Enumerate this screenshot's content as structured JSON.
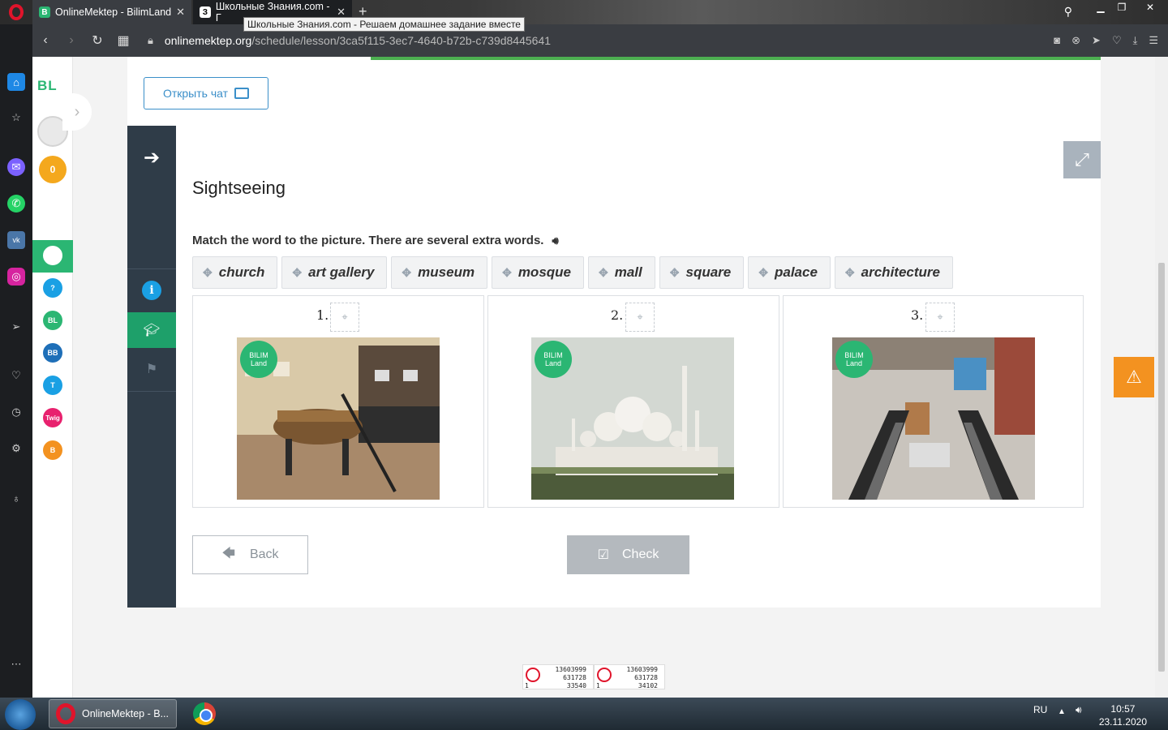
{
  "browser": {
    "tabs": [
      {
        "label": "OnlineMektep - BilimLand",
        "favicon": "B"
      },
      {
        "label": "Школьные Знания.com - Г",
        "favicon": "З"
      }
    ],
    "tooltip": "Школьные Знания.com - Решаем домашнее задание вместе",
    "url_host": "onlinemektep.org",
    "url_path": "/schedule/lesson/3ca5f115-3ec7-4640-b72b-c739d8445641"
  },
  "sidebar": {
    "logo": "BL",
    "coins": "0",
    "apps": [
      {
        "name": "online-mektep",
        "label": "",
        "color": "#2bb673"
      },
      {
        "name": "help",
        "label": "?",
        "color": "#1aa0e4"
      },
      {
        "name": "bilimland",
        "label": "BL",
        "color": "#2bb673"
      },
      {
        "name": "bilim-book",
        "label": "BB",
        "color": "#1e6fb8"
      },
      {
        "name": "bilim-test",
        "label": "T",
        "color": "#1aa0e4"
      },
      {
        "name": "twig",
        "label": "Twig",
        "color": "#e8216e"
      },
      {
        "name": "bilimal",
        "label": "B",
        "color": "#f39220"
      }
    ]
  },
  "lesson": {
    "chat_button": "Открыть чат",
    "title": "Sightseeing",
    "instruction": "Match the word to the picture. There are several extra words.",
    "words": [
      "church",
      "art gallery",
      "museum",
      "mosque",
      "mall",
      "square",
      "palace",
      "architecture"
    ],
    "cards": [
      {
        "number": "1.",
        "image": "museum-boat-photo"
      },
      {
        "number": "2.",
        "image": "mosque-photo"
      },
      {
        "number": "3.",
        "image": "mall-escalator-photo"
      }
    ],
    "image_badge": "BILIM Land",
    "back_button": "Back",
    "check_button": "Check"
  },
  "counters": [
    {
      "a": "13603999",
      "b": "631728",
      "c": "33540",
      "d": "1"
    },
    {
      "a": "13603999",
      "b": "631728",
      "c": "34102",
      "d": "1"
    }
  ],
  "taskbar": {
    "opera_label": "OnlineMektep - B...",
    "lang": "RU",
    "time": "10:57",
    "date": "23.11.2020"
  },
  "colors": {
    "accent_green": "#2bb673",
    "nav_dark": "#2f3c48",
    "link_blue": "#3b8fc9",
    "warning": "#f39220"
  }
}
